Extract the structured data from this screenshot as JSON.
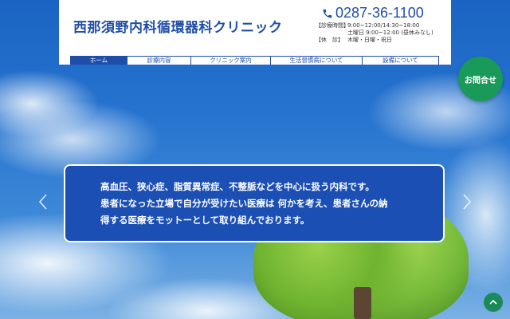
{
  "header": {
    "site_title": "西那須野内科循環器科クリニック",
    "phone": "0287-36-1100",
    "hours": {
      "label1": "【診療時間】",
      "time1": "9:00~12:00/14:30~18:00",
      "time2": "土曜日 9:00~12:00 (昼休みなし)",
      "label2": "【休　診】",
      "closed": "木曜・日曜・祝日"
    }
  },
  "nav": {
    "items": [
      {
        "label": "ホーム",
        "active": true
      },
      {
        "label": "診療内容",
        "active": false
      },
      {
        "label": "クリニック案内",
        "active": false
      },
      {
        "label": "生活習慣病について",
        "active": false
      },
      {
        "label": "設備について",
        "active": false
      }
    ]
  },
  "contact_button": {
    "label": "お問合せ"
  },
  "hero": {
    "message_lines": [
      "高血圧、狭心症、脂質異常症、不整脈などを中心に扱う内科です。",
      "患者になった立場で自分が受けたい医療は 何かを考え、患者さんの納",
      "得する医療をモットーとして取り組んでおります。"
    ]
  },
  "icons": {
    "phone": "phone-icon",
    "prev": "chevron-left-icon",
    "next": "chevron-right-icon",
    "top": "chevron-up-icon"
  },
  "colors": {
    "brand_blue": "#1f4ea8",
    "box_blue": "#1b4fb4",
    "contact_green": "#1a9a5a"
  }
}
